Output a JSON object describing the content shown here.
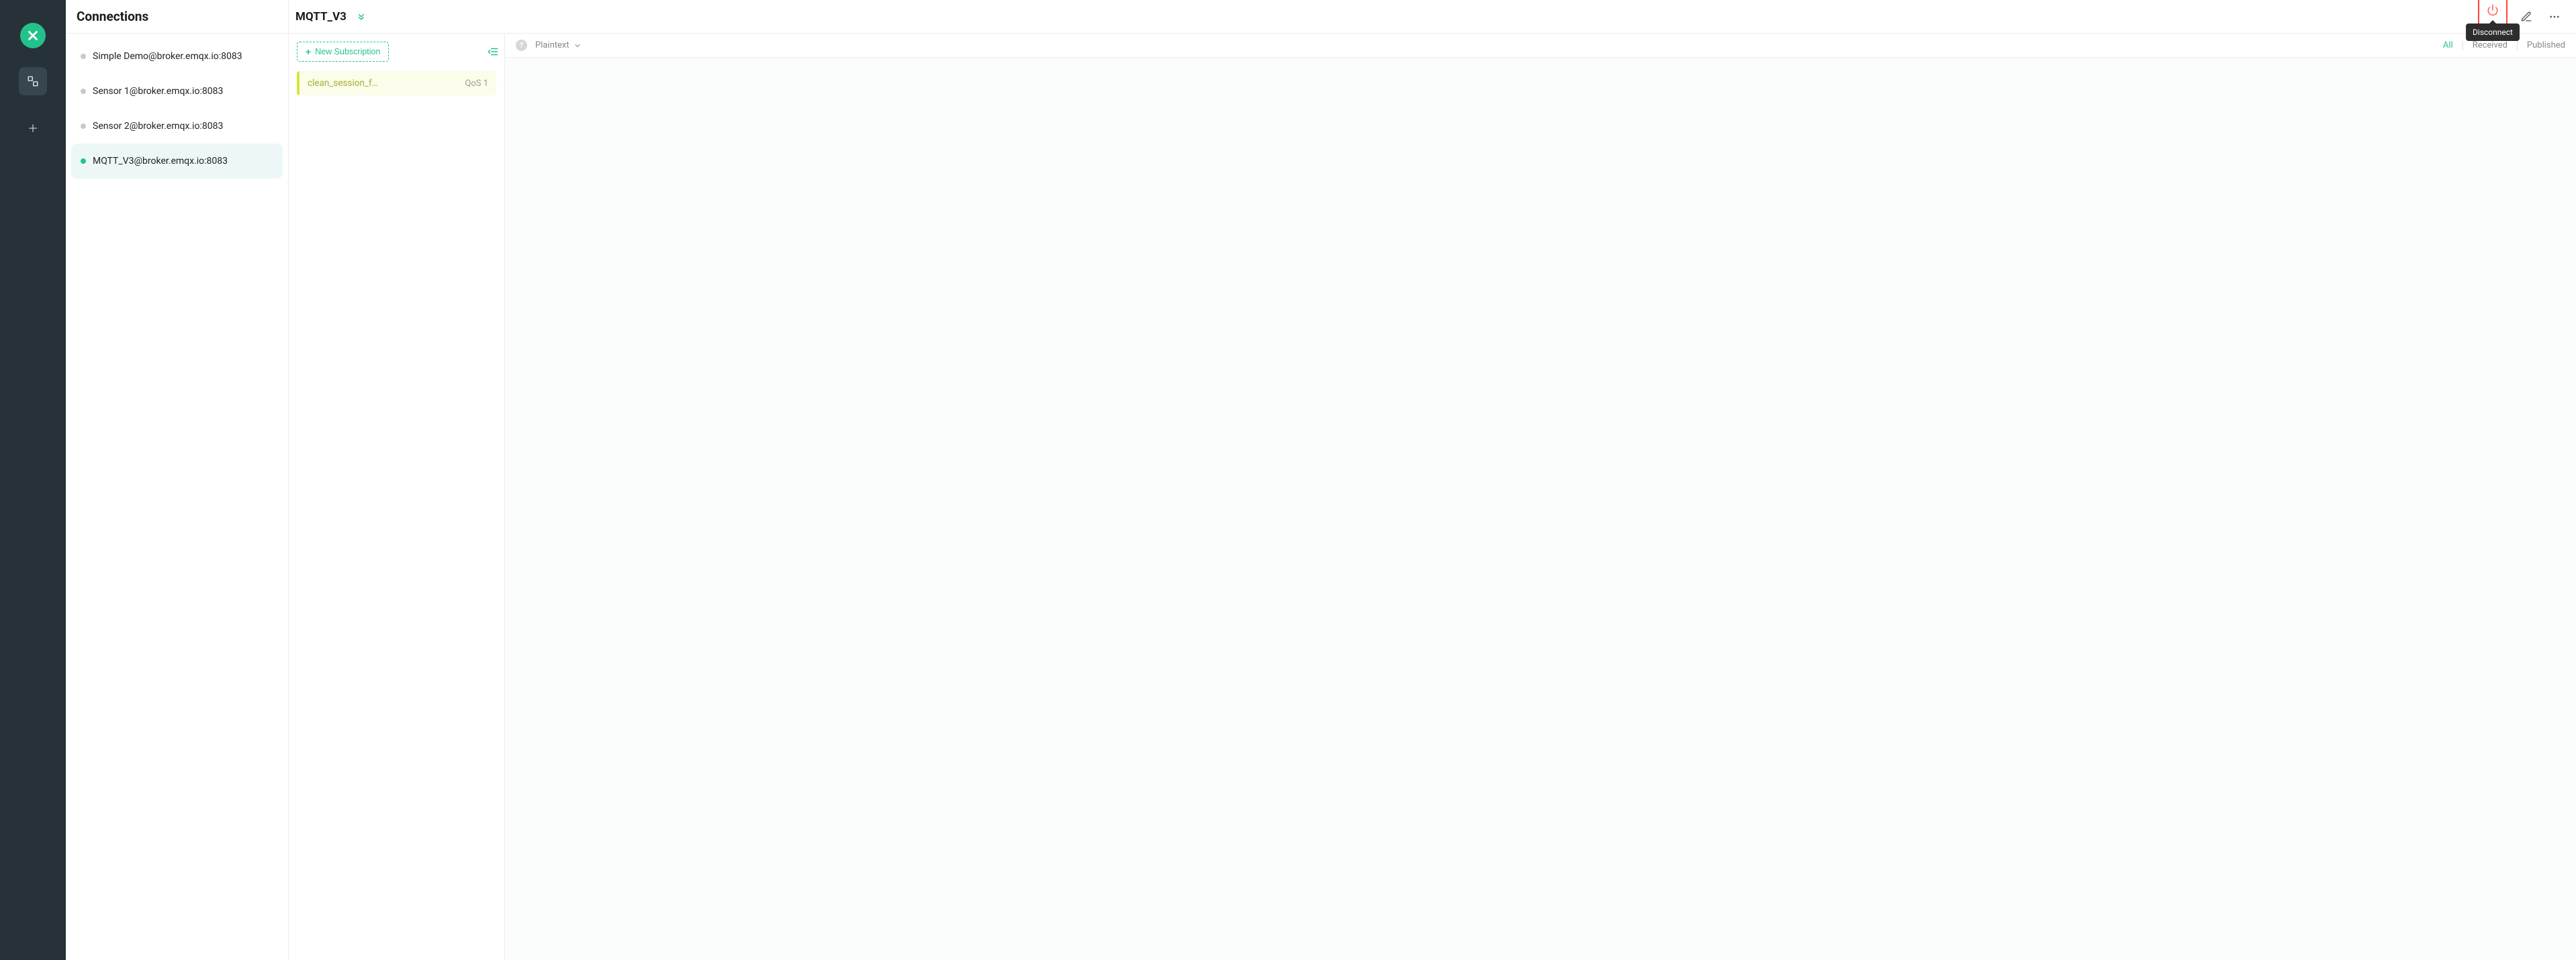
{
  "sidebar": {
    "title": "Connections",
    "items": [
      {
        "label": "Simple Demo@broker.emqx.io:8083",
        "active": false
      },
      {
        "label": "Sensor 1@broker.emqx.io:8083",
        "active": false
      },
      {
        "label": "Sensor 2@broker.emqx.io:8083",
        "active": false
      },
      {
        "label": "MQTT_V3@broker.emqx.io:8083",
        "active": true
      }
    ]
  },
  "header": {
    "connection_name": "MQTT_V3",
    "disconnect_tooltip": "Disconnect"
  },
  "subscriptions": {
    "new_label": "New Subscription",
    "items": [
      {
        "topic": "clean_session_f…",
        "qos_label": "QoS 1"
      }
    ]
  },
  "messages": {
    "format_label": "Plaintext",
    "help": "?",
    "filters": {
      "all": "All",
      "received": "Received",
      "published": "Published"
    }
  }
}
